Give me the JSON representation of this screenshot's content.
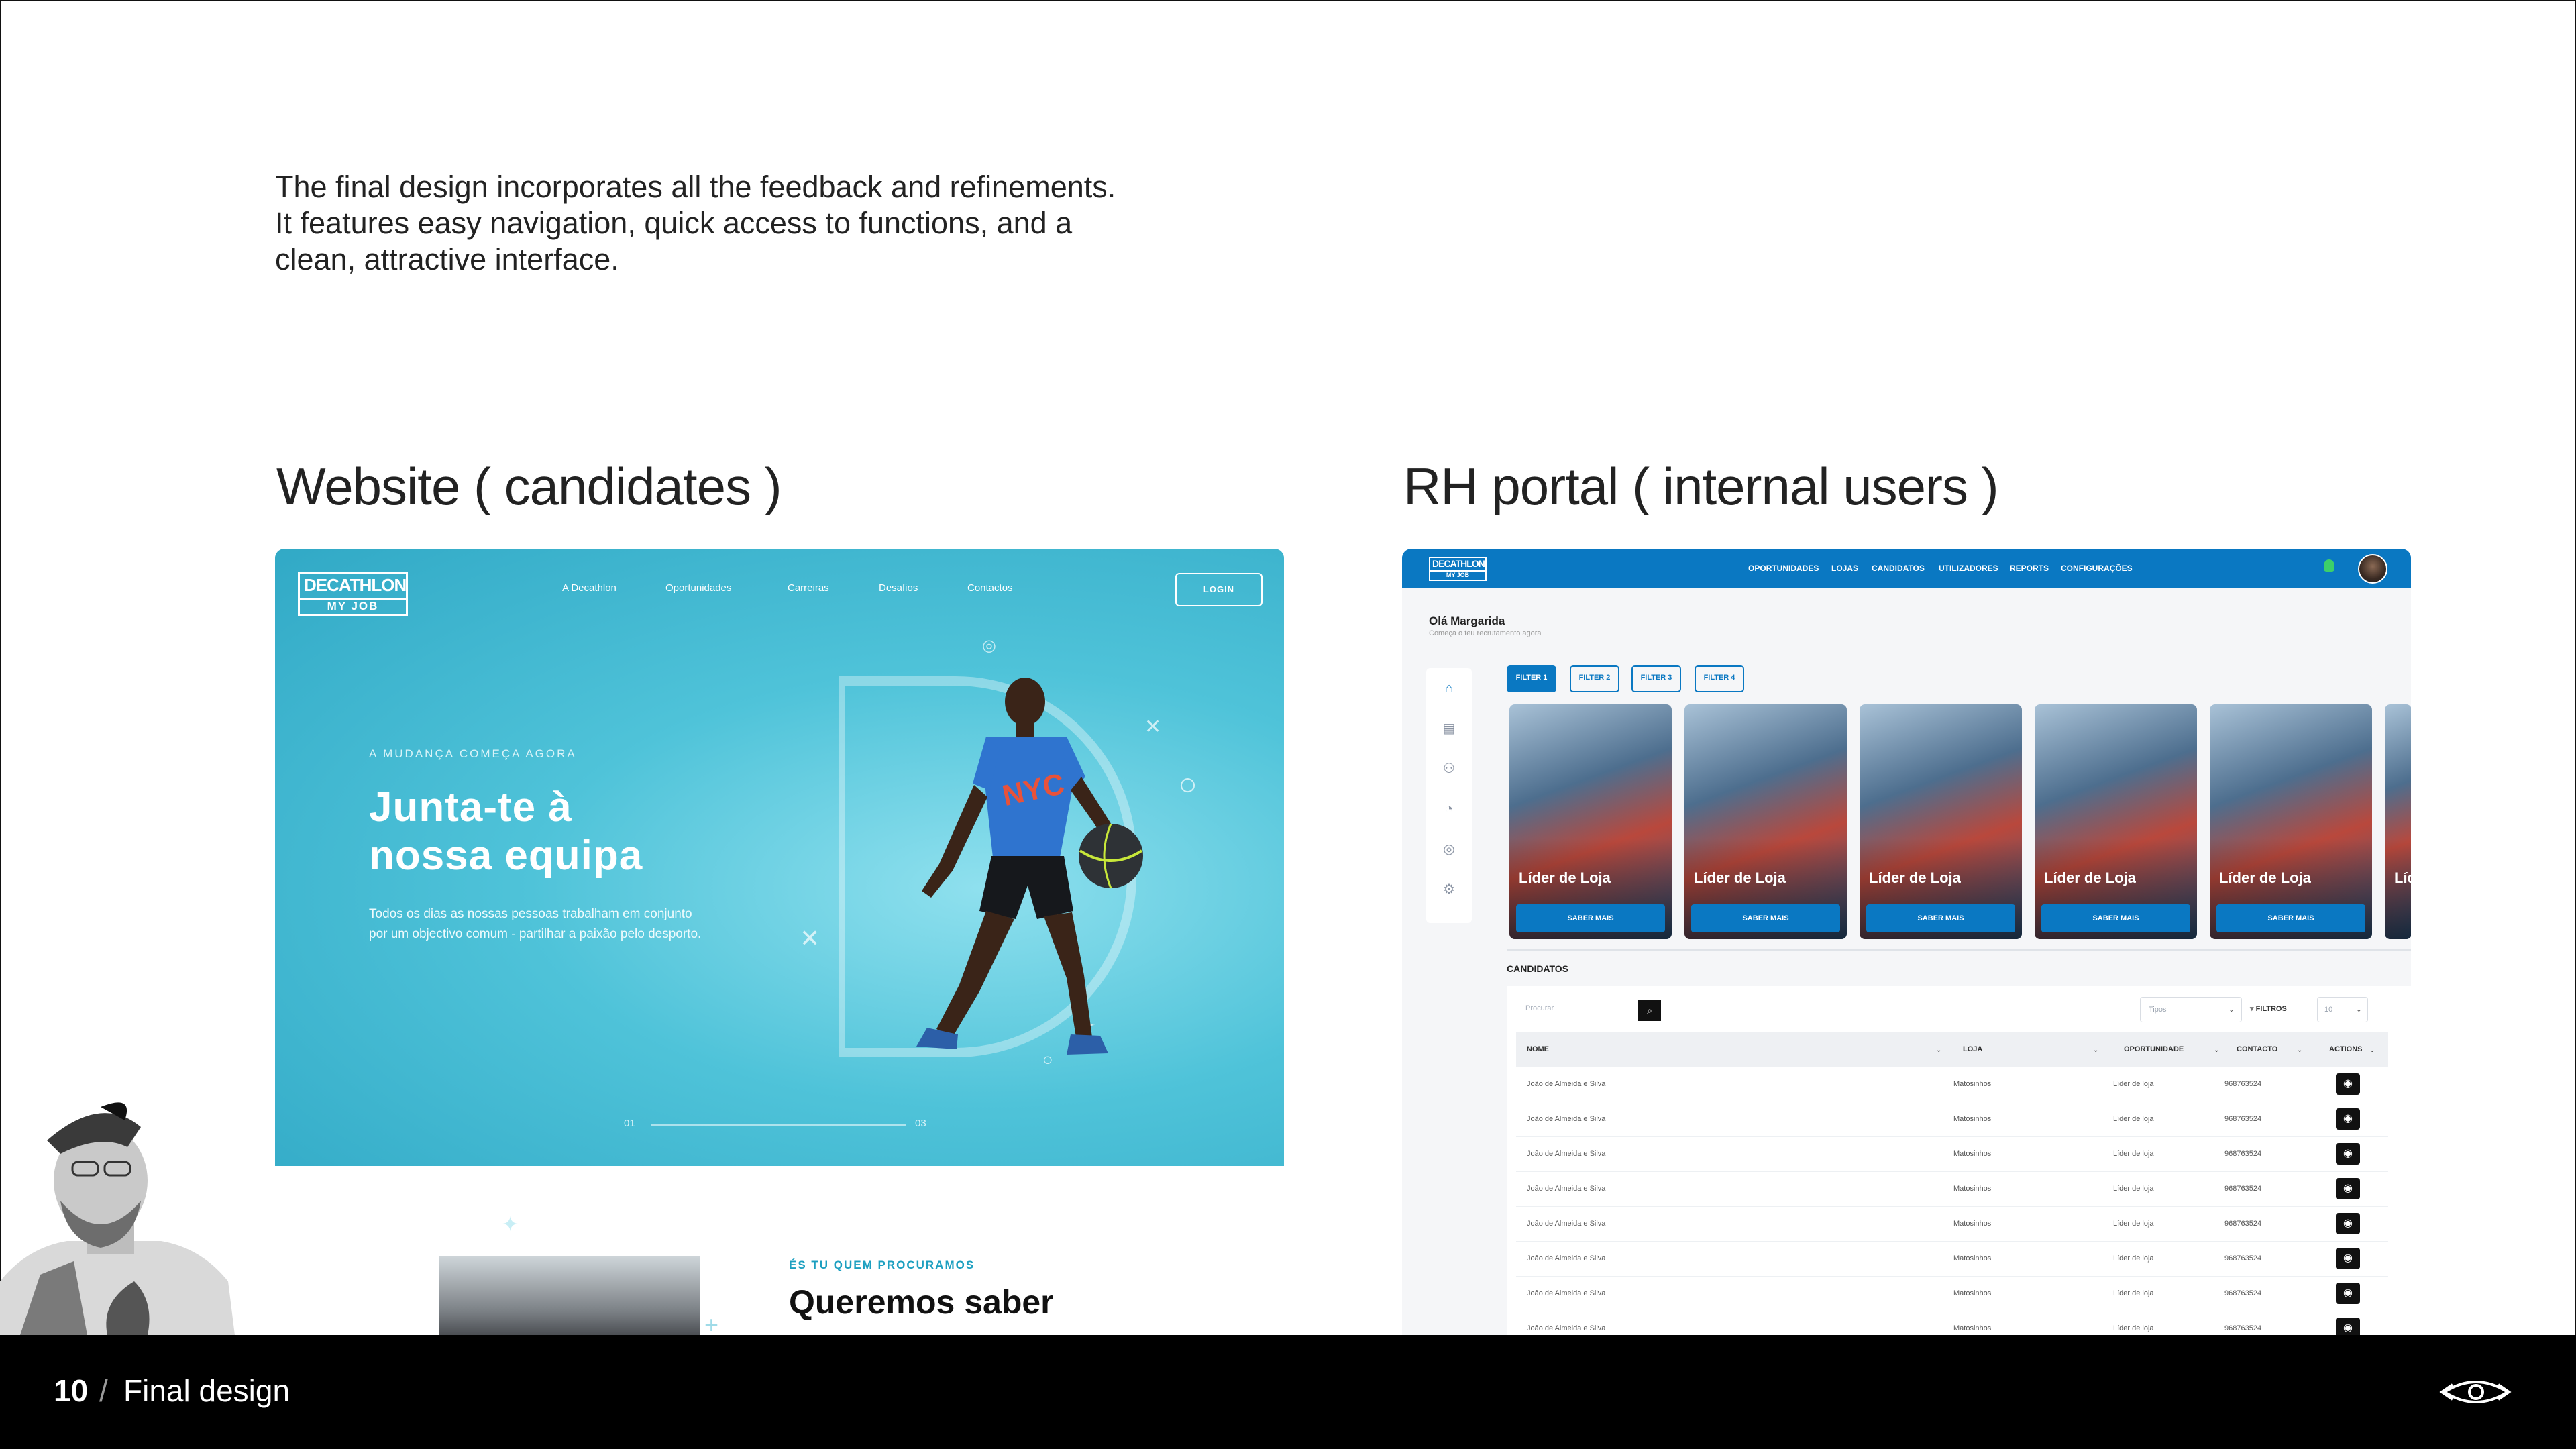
{
  "intro": {
    "line1": "The final design incorporates all the feedback and refinements.",
    "line2": "It features easy navigation, quick access to functions, and a",
    "line3": "clean, attractive interface."
  },
  "sections": {
    "website_title": "Website ( candidates )",
    "portal_title": "RH portal ( internal users )"
  },
  "website": {
    "logo_top": "DECATHLON",
    "logo_bottom": "MY JOB",
    "nav": [
      "A Decathlon",
      "Oportunidades",
      "Carreiras",
      "Desafios",
      "Contactos"
    ],
    "login": "LOGIN",
    "kicker": "A MUDANÇA COMEÇA AGORA",
    "headline_1": "Junta-te à",
    "headline_2": "nossa equipa",
    "body_1": "Todos os dias as nossas pessoas trabalham em conjunto",
    "body_2": "por um objectivo comum - partilhar a paixão pelo desporto.",
    "jersey": "NYC",
    "pager_start": "01",
    "pager_end": "03",
    "section2_kicker": "ÉS TU QUEM PROCURAMOS",
    "section2_headline": "Queremos saber"
  },
  "portal": {
    "logo_top": "DECATHLON",
    "logo_bottom": "MY JOB",
    "nav": [
      "OPORTUNIDADES",
      "LOJAS",
      "CANDIDATOS",
      "UTILIZADORES",
      "REPORTS",
      "CONFIGURAÇÕES"
    ],
    "greeting": "Olá Margarida",
    "greeting_sub": "Começa o teu recrutamento agora",
    "filters": [
      "FILTER 1",
      "FILTER 2",
      "FILTER 3",
      "FILTER 4"
    ],
    "card_title": "Líder de Loja",
    "card_button": "SABER MAIS",
    "card_partial_title": "Líd",
    "candidates_title": "CANDIDATOS",
    "search_placeholder": "Procurar",
    "tipos_placeholder": "Tipos",
    "filtros_label": "FILTROS",
    "per_page": "10",
    "columns": [
      "NOME",
      "LOJA",
      "OPORTUNIDADE",
      "CONTACTO",
      "ACTIONS"
    ],
    "row": {
      "name": "João de Almeida e Silva",
      "store": "Matosinhos",
      "opportunity": "Líder de loja",
      "contact": "968763524"
    }
  },
  "footer": {
    "page_number": "10",
    "separator": "/",
    "title": "Final design"
  },
  "colors": {
    "portal_blue": "#0a78c2",
    "website_teal": "#4fc3d9"
  }
}
